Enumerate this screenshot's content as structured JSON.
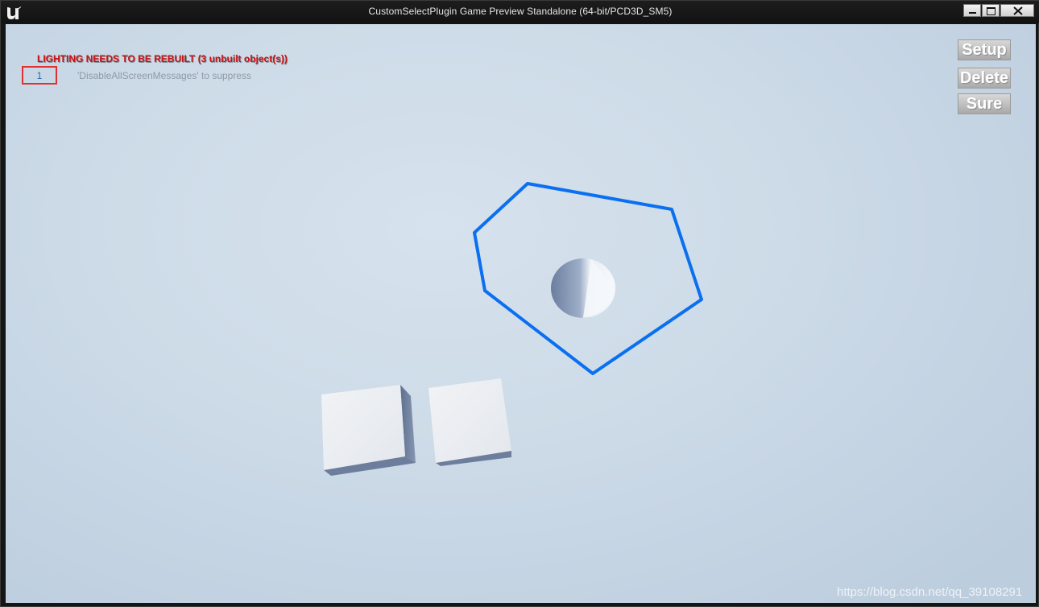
{
  "window": {
    "title": "CustomSelectPlugin Game Preview Standalone (64-bit/PCD3D_SM5)"
  },
  "messages": {
    "lighting": "LIGHTING NEEDS TO BE REBUILT (3 unbuilt object(s))",
    "count": "1",
    "suppress": "'DisableAllScreenMessages' to suppress"
  },
  "buttons": {
    "setup": "Setup",
    "delete": "Delete",
    "sure": "Sure"
  },
  "scene": {
    "selection_color": "#0a6ff0",
    "shapes": [
      "cone",
      "cube",
      "cube"
    ]
  },
  "watermark": "https://blog.csdn.net/qq_39108291",
  "icons": {
    "logo": "unreal-engine-logo-icon",
    "minimize": "minimize-icon",
    "maximize": "maximize-icon",
    "close": "close-icon"
  }
}
